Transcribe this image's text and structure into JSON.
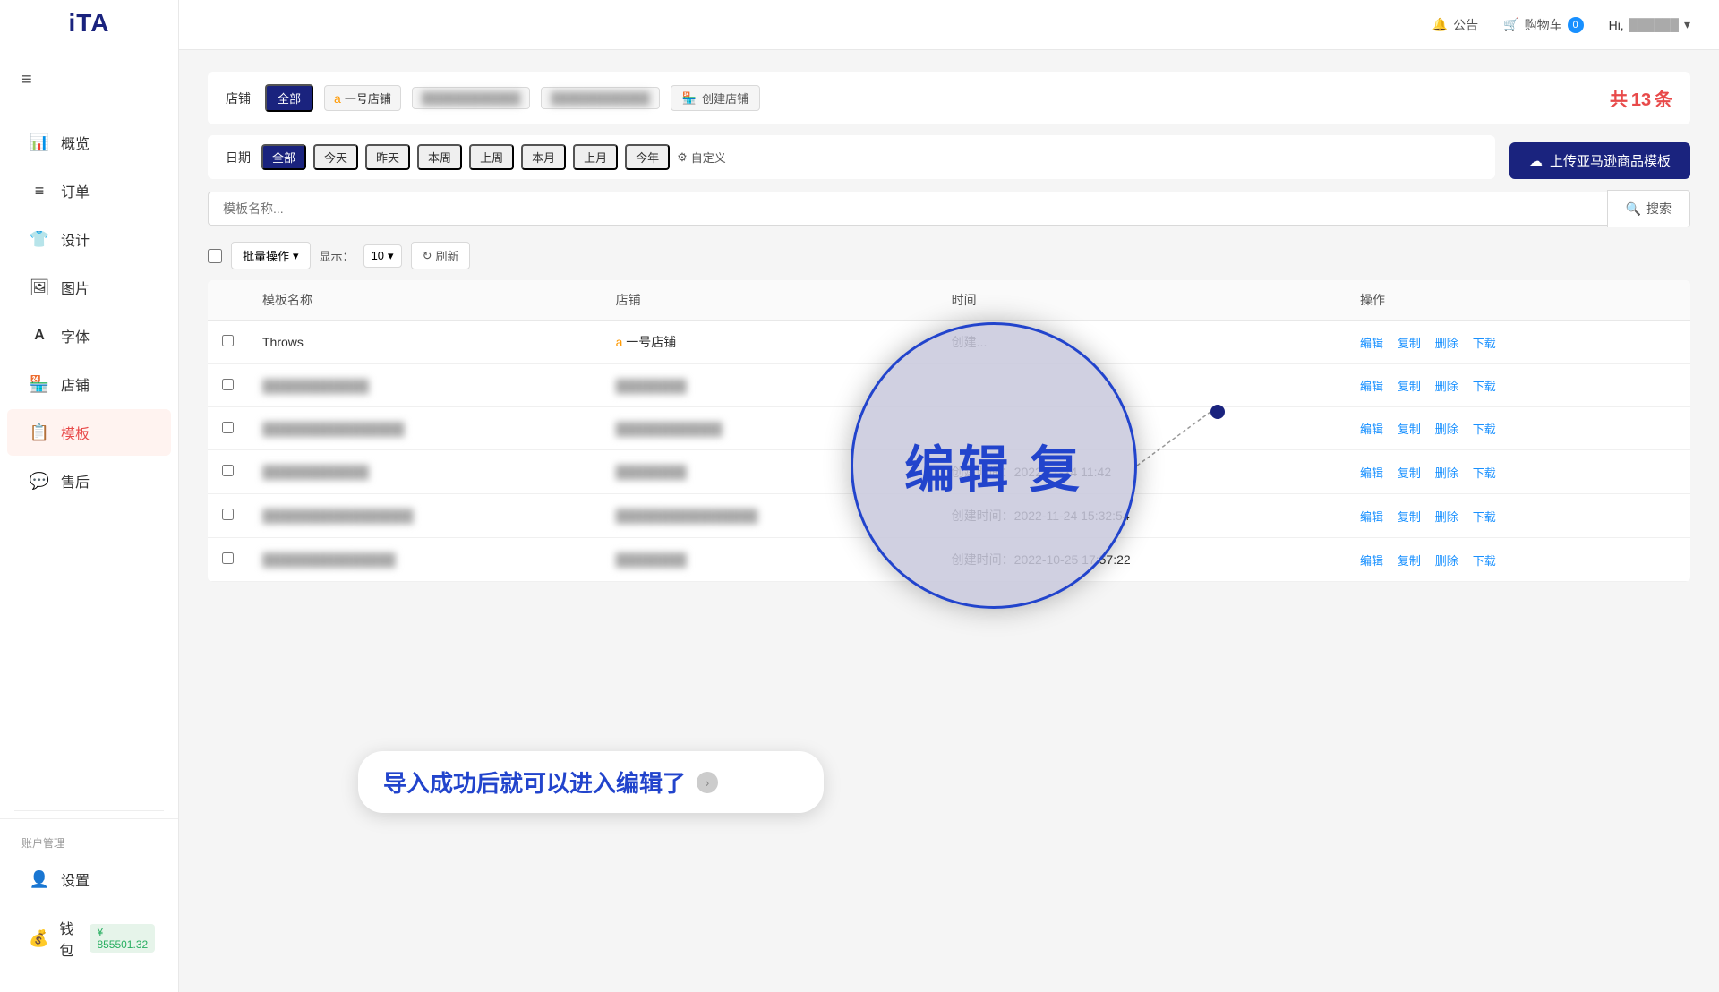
{
  "sidebar": {
    "logo": "iTA",
    "hamburger_icon": "≡",
    "items": [
      {
        "id": "overview",
        "label": "概览",
        "icon": "📊",
        "active": false
      },
      {
        "id": "orders",
        "label": "订单",
        "icon": "≡",
        "active": false
      },
      {
        "id": "design",
        "label": "设计",
        "icon": "👕",
        "active": false
      },
      {
        "id": "images",
        "label": "图片",
        "icon": "🖼",
        "active": false
      },
      {
        "id": "fonts",
        "label": "字体",
        "icon": "A",
        "active": false
      },
      {
        "id": "stores",
        "label": "店铺",
        "icon": "🏪",
        "active": false
      },
      {
        "id": "templates",
        "label": "模板",
        "icon": "📋",
        "active": true
      },
      {
        "id": "aftersales",
        "label": "售后",
        "icon": "💬",
        "active": false
      }
    ],
    "section_account": "账户管理",
    "account_items": [
      {
        "id": "settings",
        "label": "设置",
        "icon": "👤"
      },
      {
        "id": "wallet",
        "label": "钱包",
        "icon": "💰",
        "badge": "¥ 855501.32"
      }
    ]
  },
  "topbar": {
    "notice_label": "公告",
    "cart_label": "购物车",
    "cart_count": "0",
    "hi_label": "Hi,",
    "user_name": "用户"
  },
  "filters": {
    "store_label": "店铺",
    "all_label": "全部",
    "store1_label": "一号店铺",
    "store2_label": "店铺2",
    "store3_label": "店铺3",
    "create_store_label": "创建店铺",
    "total_label": "共",
    "total_count": "13",
    "total_unit": "条",
    "upload_btn_label": "上传亚马逊商品模板",
    "date_label": "日期",
    "date_all": "全部",
    "date_today": "今天",
    "date_yesterday": "昨天",
    "date_this_week": "本周",
    "date_last_week": "上周",
    "date_this_month": "本月",
    "date_last_month": "上月",
    "date_this_year": "今年",
    "date_custom": "自定义",
    "search_placeholder": "模板名称...",
    "search_btn_label": "搜索"
  },
  "table_controls": {
    "batch_label": "批量操作",
    "show_label": "显示：",
    "show_value": "10",
    "refresh_label": "刷新"
  },
  "table": {
    "headers": [
      "模板名称",
      "店铺",
      "时间",
      "操作"
    ],
    "rows": [
      {
        "checkbox": false,
        "name": "Throws",
        "store": "一号店铺",
        "time": "创建...",
        "actions": [
          "编辑",
          "复制",
          "删除",
          "下载"
        ],
        "blurred": false,
        "highlighted": true
      },
      {
        "checkbox": false,
        "name": "模板名称2",
        "store": "店铺名称",
        "time": "",
        "actions": [
          "编辑",
          "复制",
          "删除",
          "下载"
        ],
        "blurred": true
      },
      {
        "checkbox": false,
        "name": "模板名称3",
        "store": "店铺名称",
        "time": "",
        "actions": [
          "编辑",
          "复制",
          "删除",
          "下载"
        ],
        "blurred": true
      },
      {
        "checkbox": false,
        "name": "模板名称4",
        "store": "店铺名称",
        "time": "创建时间：2022-11-24 11:42",
        "actions": [
          "编辑",
          "复制",
          "删除",
          "下载"
        ],
        "blurred": true
      },
      {
        "checkbox": false,
        "name": "模板名称5",
        "store": "店铺名称",
        "time": "创建时间：2022-11-24 15:32:54",
        "actions": [
          "编辑",
          "复制",
          "删除",
          "下载"
        ],
        "blurred": true
      },
      {
        "checkbox": false,
        "name": "模板名称6",
        "store": "店铺名称",
        "time": "创建时间：2022-10-25 17:57:22",
        "actions": [
          "编辑",
          "复制",
          "删除",
          "下载"
        ],
        "blurred": true
      }
    ]
  },
  "annotation": {
    "zoom_text": "编辑  复",
    "tooltip_text": "导入成功后就可以进入编辑了",
    "dot_color": "#1a237e"
  }
}
